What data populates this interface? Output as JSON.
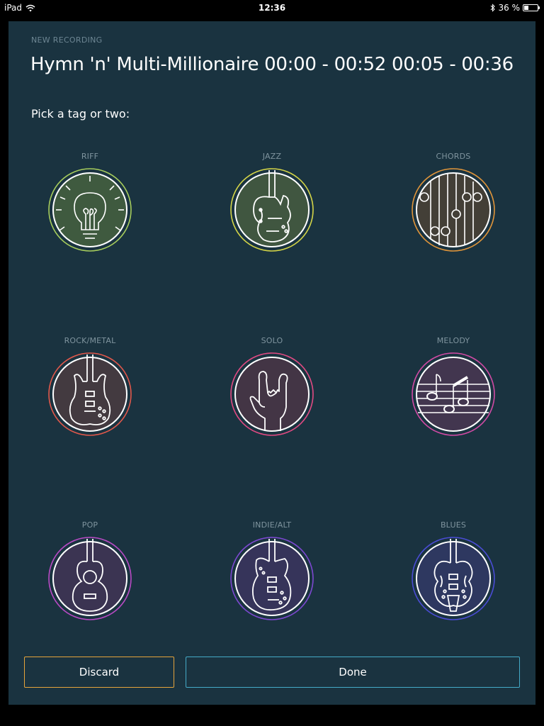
{
  "status_bar": {
    "device": "iPad",
    "time": "12:36",
    "battery": "36 %",
    "battery_level": 0.36
  },
  "header": {
    "kicker": "NEW RECORDING",
    "title": "Hymn 'n' Multi-Millionaire 00:00 - 00:52 00:05 - 00:36"
  },
  "prompt": "Pick a tag or two:",
  "tags": [
    {
      "label": "RIFF",
      "icon": "lightbulb-icon",
      "ring": "#a6cc5c",
      "fill": "#3f5a3f"
    },
    {
      "label": "JAZZ",
      "icon": "jazz-guitar-icon",
      "ring": "#d3d447",
      "fill": "#405640"
    },
    {
      "label": "CHORDS",
      "icon": "chord-chart-icon",
      "ring": "#e0953a",
      "fill": "#433f37"
    },
    {
      "label": "ROCK/METAL",
      "icon": "sg-guitar-icon",
      "ring": "#e0584b",
      "fill": "#433a40"
    },
    {
      "label": "SOLO",
      "icon": "rock-hand-icon",
      "ring": "#e04a82",
      "fill": "#433545"
    },
    {
      "label": "MELODY",
      "icon": "music-notes-icon",
      "ring": "#d04aa4",
      "fill": "#42364f"
    },
    {
      "label": "POP",
      "icon": "acoustic-guitar-icon",
      "ring": "#b84ac4",
      "fill": "#3b3452"
    },
    {
      "label": "INDIE/ALT",
      "icon": "offset-guitar-icon",
      "ring": "#7c48d0",
      "fill": "#36345a"
    },
    {
      "label": "BLUES",
      "icon": "semi-hollow-guitar-icon",
      "ring": "#4a4cd4",
      "fill": "#2e3860"
    }
  ],
  "actions": {
    "discard_label": "Discard",
    "done_label": "Done",
    "discard_color": "#e6a43b",
    "done_color": "#45aac8"
  }
}
